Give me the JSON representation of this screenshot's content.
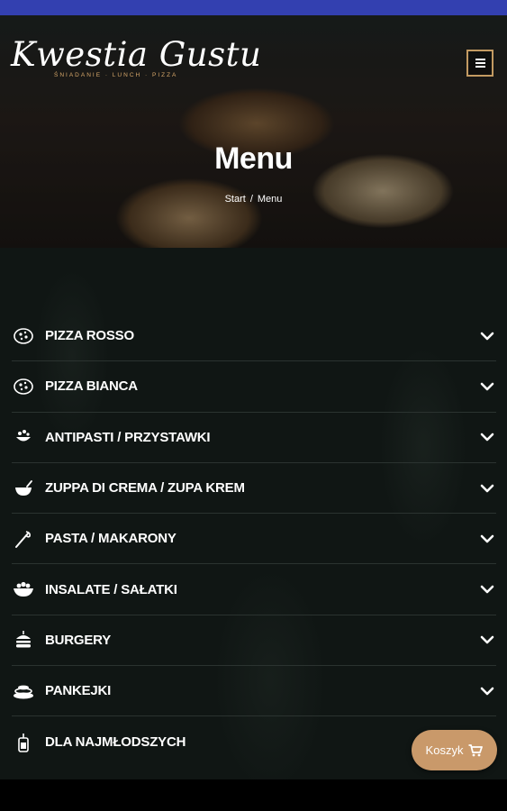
{
  "brand": {
    "logo_text": "Kwestia Gustu",
    "tagline": "ŚNIADANIE · LUNCH · PIZZA"
  },
  "hero": {
    "title": "Menu",
    "breadcrumb": {
      "home": "Start",
      "separator": "/",
      "current": "Menu"
    }
  },
  "categories": [
    {
      "label": "PIZZA ROSSO",
      "icon": "pizza-icon"
    },
    {
      "label": "PIZZA BIANCA",
      "icon": "pizza-icon"
    },
    {
      "label": "ANTIPASTI / PRZYSTAWKI",
      "icon": "appetizer-icon"
    },
    {
      "label": "ZUPPA DI CREMA / ZUPA KREM",
      "icon": "soup-bowl-icon"
    },
    {
      "label": "PASTA / MAKARONY",
      "icon": "pasta-fork-icon"
    },
    {
      "label": "INSALATE / SAŁATKI",
      "icon": "salad-bowl-icon"
    },
    {
      "label": "BURGERY",
      "icon": "burger-icon"
    },
    {
      "label": "PANKEJKI",
      "icon": "pancakes-icon"
    },
    {
      "label": "DLA NAJMŁODSZYCH",
      "icon": "kids-drink-icon"
    }
  ],
  "cart": {
    "label": "Koszyk",
    "icon": "cart-icon"
  },
  "colors": {
    "accent": "#c9996a",
    "status_bar": "#3340b0",
    "background": "#101614"
  }
}
